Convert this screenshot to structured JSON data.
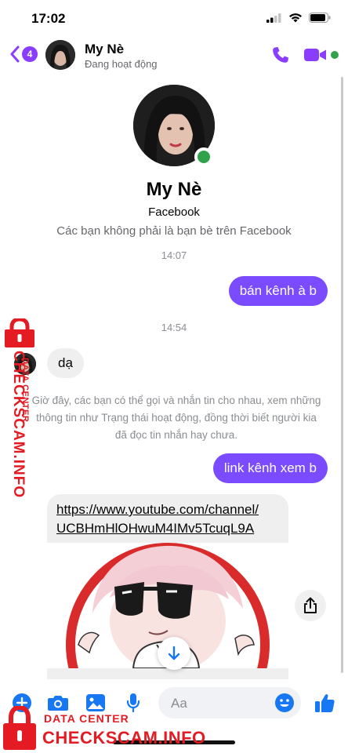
{
  "status_bar": {
    "time": "17:02"
  },
  "header": {
    "back_badge": "4",
    "name": "My Nè",
    "status": "Đang hoạt động"
  },
  "profile": {
    "name": "My Nè",
    "platform": "Facebook",
    "note": "Các bạn không phải là bạn bè trên Facebook"
  },
  "messages": {
    "time1": "14:07",
    "out1": "bán kênh à b",
    "time2": "14:54",
    "in1": "dạ",
    "system_note": "Giờ đây, các bạn có thể gọi và nhắn tin cho nhau, xem những thông tin như Trạng thái hoạt động, đồng thời biết người kia đã đọc tin nhắn hay chưa.",
    "out2": "link kênh xem b",
    "link_line1": "https://www.youtube.com/channel/",
    "link_line2": "UCBHmHlOHwuM4IMv5TcuqL9A"
  },
  "composer": {
    "placeholder": "Aa"
  },
  "watermark": {
    "vertical_main": "CHECKSCAM.INFO",
    "vertical_small": "DATA CENTER",
    "bottom_title": "DATA CENTER",
    "bottom_main": "CHECKSCAM.INFO"
  },
  "colors": {
    "accent": "#7b4bff",
    "online": "#31a24c",
    "watermark": "#e41b23"
  }
}
